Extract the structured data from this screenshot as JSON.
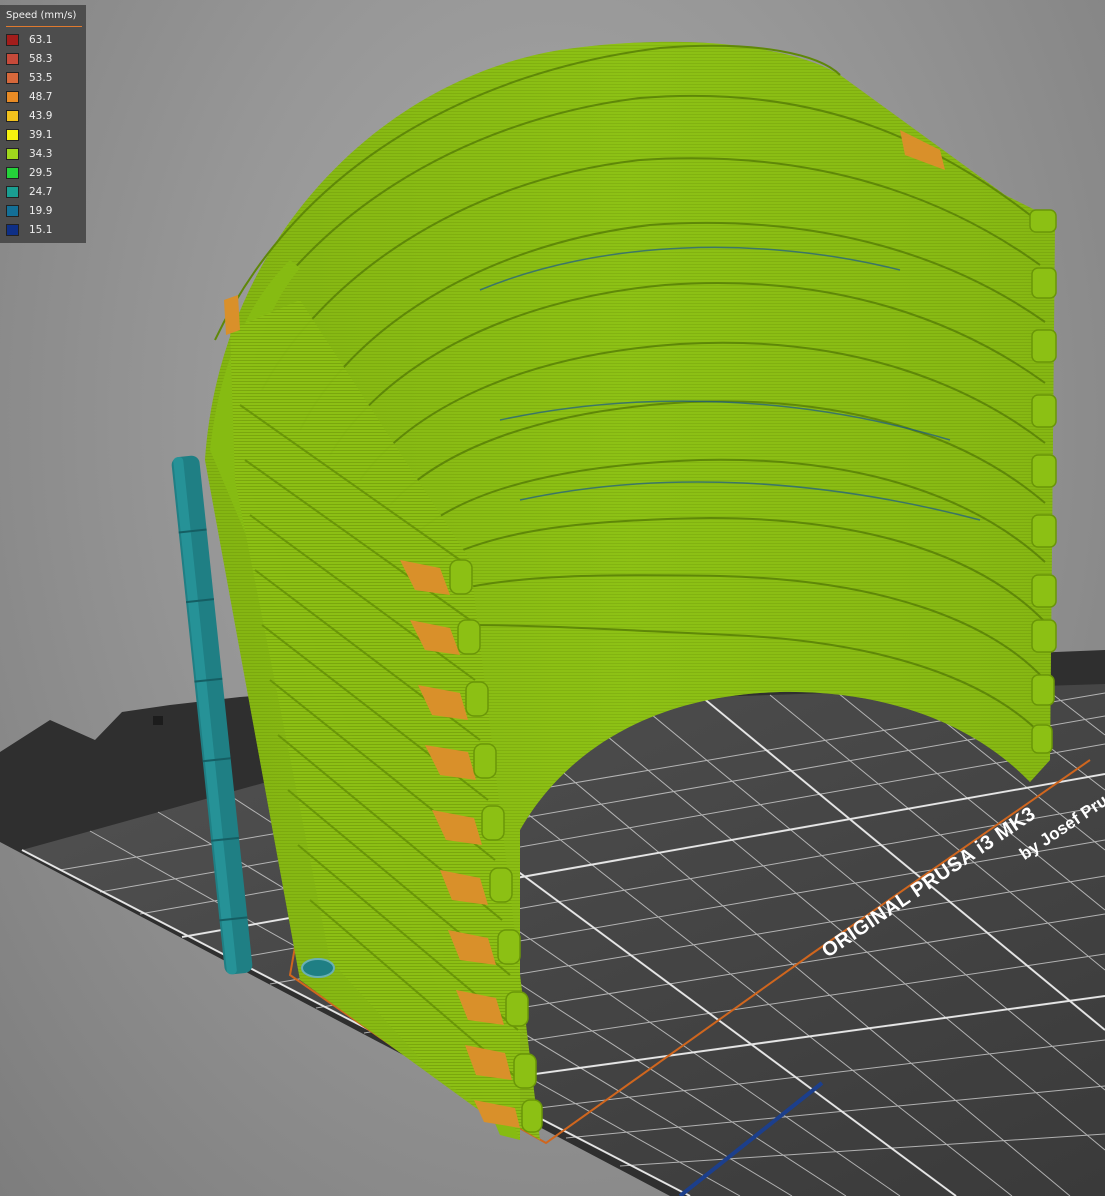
{
  "legend": {
    "title": "Speed (mm/s)",
    "entries": [
      {
        "value": "63.1",
        "color": "#a21d1b"
      },
      {
        "value": "58.3",
        "color": "#c64a3a"
      },
      {
        "value": "53.5",
        "color": "#d6683b"
      },
      {
        "value": "48.7",
        "color": "#e88b25"
      },
      {
        "value": "43.9",
        "color": "#f2c21d"
      },
      {
        "value": "39.1",
        "color": "#f6f20f"
      },
      {
        "value": "34.3",
        "color": "#a0d81c"
      },
      {
        "value": "29.5",
        "color": "#25d23a"
      },
      {
        "value": "24.7",
        "color": "#1a9e92"
      },
      {
        "value": "19.9",
        "color": "#146f96"
      },
      {
        "value": "15.1",
        "color": "#0e2f86"
      }
    ]
  },
  "bed": {
    "label": "ORIGINAL PRUSA i3 MK3",
    "sublabel": "by Josef Pru"
  },
  "colors": {
    "extrusion_main": "#8cc014",
    "extrusion_dark": "#6f9a0c",
    "extrusion_highlight": "#a6d62a",
    "infill": "#d9902a",
    "support": "#1f7f84",
    "travel": "#c9621f",
    "bed_surface": "#4a4a4a",
    "bed_grid": "#e2e2e2"
  }
}
